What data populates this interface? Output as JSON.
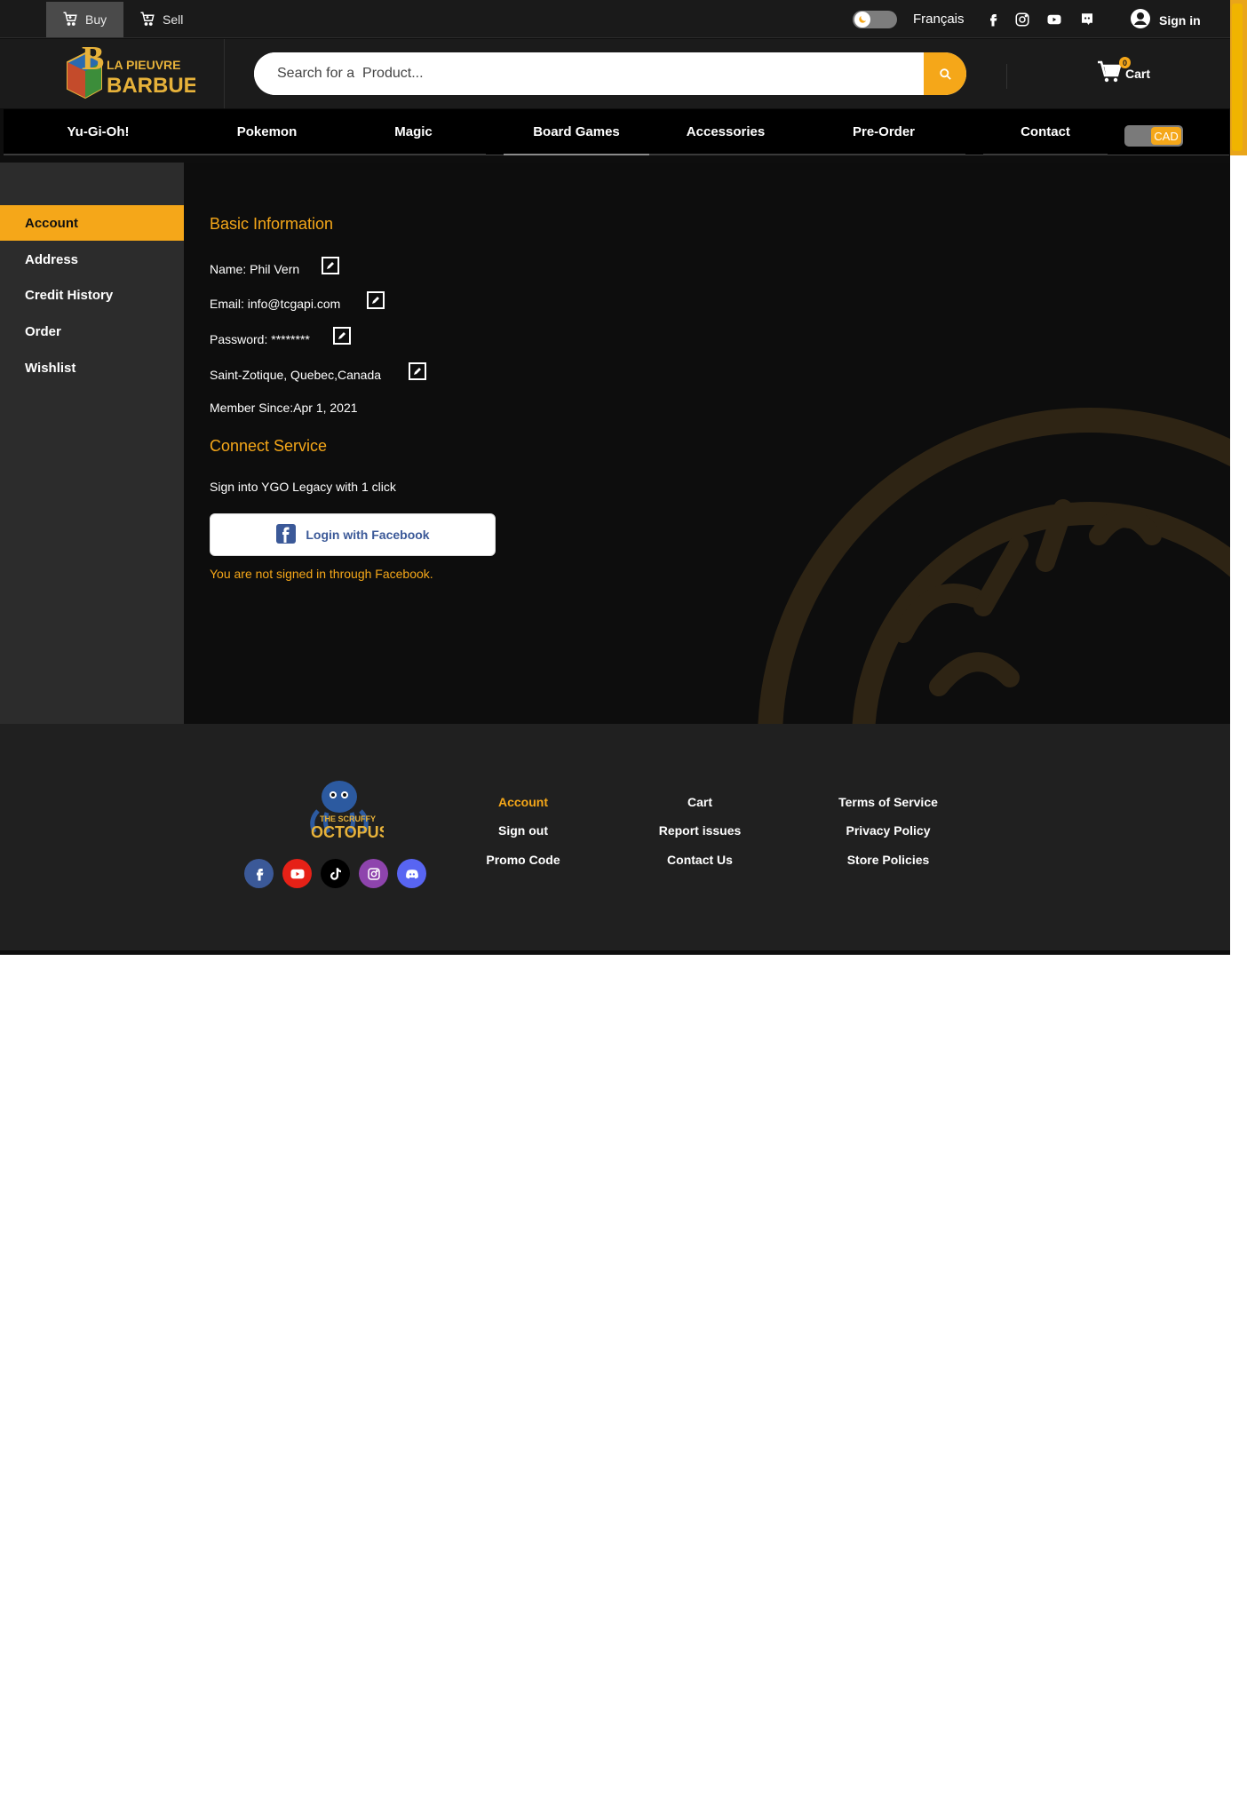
{
  "topbar": {
    "mode_tabs": [
      {
        "label": "Buy",
        "icon": "cart-icon",
        "active": true
      },
      {
        "label": "Sell",
        "icon": "cart-icon",
        "active": false
      }
    ],
    "theme_toggle_icon": "moon-icon",
    "language_link": "Français",
    "social_icons": [
      "facebook-icon",
      "instagram-icon",
      "youtube-icon",
      "discord-icon"
    ],
    "signin_label": "Sign in",
    "signin_icon": "user-circle-icon"
  },
  "header": {
    "logo_alt": "La Pieuvre Barbue",
    "logo_text_line1": "LA PIEUVRE",
    "logo_text_line2": "BARBUE",
    "search_placeholder": "Search for a  Product...",
    "search_icon": "search-icon",
    "cart_label": "Cart",
    "cart_count": "0"
  },
  "nav": {
    "categories": [
      "Yu-Gi-Oh!",
      "Pokemon",
      "Magic",
      "Board Games",
      "Accessories",
      "Pre-Order",
      "Contact"
    ],
    "active_category": "Board Games",
    "currency_label": "CAD"
  },
  "sidebar": {
    "items": [
      {
        "label": "Account",
        "active": true
      },
      {
        "label": "Address",
        "active": false
      },
      {
        "label": "Credit History",
        "active": false
      },
      {
        "label": "Order",
        "active": false
      },
      {
        "label": "Wishlist",
        "active": false
      }
    ]
  },
  "account": {
    "basic_info_title": "Basic Information",
    "name_line": "Name: Phil Vern",
    "email_line": "Email: info@tcgapi.com",
    "password_line": "Password: ********",
    "location_line": "Saint-Zotique, Quebec,Canada",
    "member_since_line": "Member Since:Apr 1, 2021",
    "connect_title": "Connect Service",
    "connect_desc": "Sign into YGO Legacy with 1 click",
    "facebook_button": "Login with Facebook",
    "facebook_note": "You are not signed in through Facebook."
  },
  "footer": {
    "logo_alt": "The Scruffy Octopus",
    "logo_text_small": "THE SCRUFFY",
    "logo_text_big": "OCTOPUS",
    "social_icons": [
      "facebook-icon",
      "youtube-icon",
      "tiktok-icon",
      "instagram-icon",
      "discord-icon"
    ],
    "col1": [
      "Account",
      "Sign out",
      "Promo Code"
    ],
    "col2": [
      "Cart",
      "Report issues",
      "Contact Us"
    ],
    "col3": [
      "Terms of Service",
      "Privacy Policy",
      "Store Policies"
    ]
  },
  "colors": {
    "accent": "#f5a719",
    "page_bg": "#0e0e0e",
    "sidebar_bg": "#2c2c2c",
    "footer_bg": "#202020",
    "facebook_blue": "#3b5998"
  }
}
